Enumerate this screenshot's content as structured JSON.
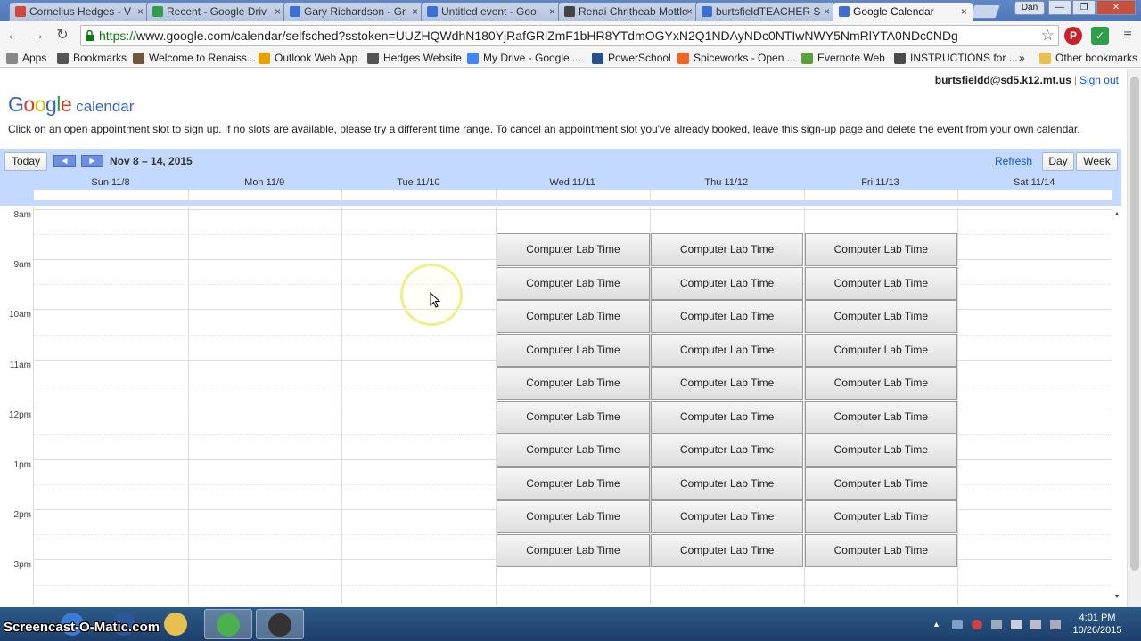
{
  "browser": {
    "tabs": [
      {
        "title": "Cornelius Hedges - V",
        "color": "#d44638"
      },
      {
        "title": "Recent - Google Driv",
        "color": "#2e9e49"
      },
      {
        "title": "Gary Richardson - Gr",
        "color": "#3b6fd6"
      },
      {
        "title": "Untitled event - Goo",
        "color": "#3b6fd6"
      },
      {
        "title": "Renai Chritheab Mottle",
        "color": "#444444"
      },
      {
        "title": "burtsfieldTEACHER S",
        "color": "#3b6fd6"
      },
      {
        "title": "Google Calendar",
        "color": "#3b6fd6"
      }
    ],
    "active_tab_index": 6,
    "profile_label": "Dan",
    "url_scheme": "https://",
    "url_rest": "www.google.com/calendar/selfsched?sstoken=UUZHQWdhN180YjRafGRlZmF1bHR8YTdmOGYxN2Q1NDAyNDc0NTIwNWY5NmRlYTA0NDc0NDg",
    "bookmarks": [
      {
        "label": "Apps",
        "icon": "apps-grid-icon",
        "color": "#888888"
      },
      {
        "label": "Bookmarks",
        "icon": "star-icon",
        "color": "#555555"
      },
      {
        "label": "Welcome to Renaiss...",
        "icon": "building-icon",
        "color": "#6b5a3a"
      },
      {
        "label": "Outlook Web App",
        "icon": "outlook-icon",
        "color": "#e8a200"
      },
      {
        "label": "Hedges Website",
        "icon": "globe-icon",
        "color": "#555555"
      },
      {
        "label": "My Drive - Google ...",
        "icon": "google-g-icon",
        "color": "#4285f4"
      },
      {
        "label": "PowerSchool",
        "icon": "powerschool-icon",
        "color": "#2b4f8c"
      },
      {
        "label": "Spiceworks - Open ...",
        "icon": "spiceworks-icon",
        "color": "#f26522"
      },
      {
        "label": "Evernote Web",
        "icon": "evernote-icon",
        "color": "#5aa33b"
      },
      {
        "label": "INSTRUCTIONS for ...",
        "icon": "document-icon",
        "color": "#4a4a4a"
      }
    ],
    "bookmarks_overflow": "»",
    "other_bookmarks": "Other bookmarks"
  },
  "page": {
    "account_email": "burtsfieldd@sd5.k12.mt.us",
    "sign_out": "Sign out",
    "logo_letters": [
      "G",
      "o",
      "o",
      "g",
      "l",
      "e"
    ],
    "logo_product": "calendar",
    "instructions": "Click on an open appointment slot to sign up. If no slots are available, please try a different time range. To cancel an appointment slot you've already booked, leave this sign-up page and delete the event from your own calendar."
  },
  "calendar": {
    "today_button": "Today",
    "date_range": "Nov 8 – 14, 2015",
    "refresh": "Refresh",
    "view_day": "Day",
    "view_week": "Week",
    "days": [
      "Sun 11/8",
      "Mon 11/9",
      "Tue 11/10",
      "Wed 11/11",
      "Thu 11/12",
      "Fri 11/13",
      "Sat 11/14"
    ],
    "hours": [
      "8am",
      "9am",
      "10am",
      "11am",
      "12pm",
      "1pm",
      "2pm",
      "3pm"
    ],
    "slot_label": "Computer Lab Time",
    "slot_days": [
      3,
      4,
      5
    ],
    "slot_count_per_day": 10
  },
  "taskbar": {
    "watermark": "Screencast-O-Matic.com",
    "time": "4:01 PM",
    "date": "10/26/2015",
    "apps": [
      {
        "name": "ie-icon",
        "color": "#3a7bd5",
        "active": false
      },
      {
        "name": "word-icon",
        "color": "#2b579a",
        "active": false
      },
      {
        "name": "folder-icon",
        "color": "#e8c050",
        "active": false
      },
      {
        "name": "chrome-icon",
        "color": "#4caf50",
        "active": true
      },
      {
        "name": "screen-capture-icon",
        "color": "#333333",
        "active": true
      }
    ]
  }
}
